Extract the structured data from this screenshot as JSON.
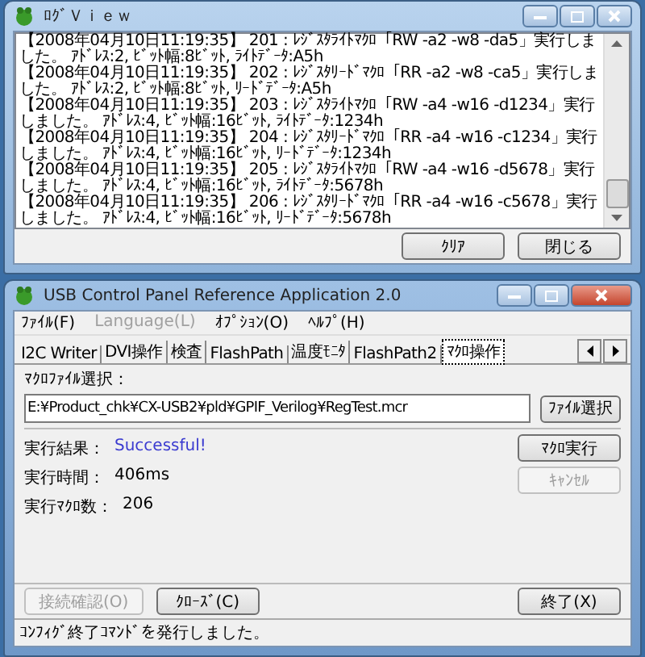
{
  "log_window": {
    "title": "ﾛｸﾞＶｉｅｗ",
    "lines": [
      "【2008年04月10日11:19:35】 201 : ﾚｼﾞｽﾀﾗｲﾄﾏｸﾛ「RW -a2 -w8 -da5」実行しました。 ｱﾄﾞﾚｽ:2, ﾋﾞｯﾄ幅:8ﾋﾞｯﾄ, ﾗｲﾄﾃﾞｰﾀ:A5h",
      "【2008年04月10日11:19:35】 202 : ﾚｼﾞｽﾀﾘｰﾄﾞﾏｸﾛ「RR -a2 -w8 -ca5」実行しました。 ｱﾄﾞﾚｽ:2, ﾋﾞｯﾄ幅:8ﾋﾞｯﾄ, ﾘｰﾄﾞﾃﾞｰﾀ:A5h",
      "【2008年04月10日11:19:35】 203 : ﾚｼﾞｽﾀﾗｲﾄﾏｸﾛ「RW -a4 -w16 -d1234」実行しました。 ｱﾄﾞﾚｽ:4, ﾋﾞｯﾄ幅:16ﾋﾞｯﾄ, ﾗｲﾄﾃﾞｰﾀ:1234h",
      "【2008年04月10日11:19:35】 204 : ﾚｼﾞｽﾀﾘｰﾄﾞﾏｸﾛ「RR -a4 -w16 -c1234」実行しました。 ｱﾄﾞﾚｽ:4, ﾋﾞｯﾄ幅:16ﾋﾞｯﾄ, ﾘｰﾄﾞﾃﾞｰﾀ:1234h",
      "【2008年04月10日11:19:35】 205 : ﾚｼﾞｽﾀﾗｲﾄﾏｸﾛ「RW -a4 -w16 -d5678」実行しました。 ｱﾄﾞﾚｽ:4, ﾋﾞｯﾄ幅:16ﾋﾞｯﾄ, ﾗｲﾄﾃﾞｰﾀ:5678h",
      "【2008年04月10日11:19:35】 206 : ﾚｼﾞｽﾀﾘｰﾄﾞﾏｸﾛ「RR -a4 -w16 -c5678」実行しました。 ｱﾄﾞﾚｽ:4, ﾋﾞｯﾄ幅:16ﾋﾞｯﾄ, ﾘｰﾄﾞﾃﾞｰﾀ:5678h"
    ],
    "buttons": [
      {
        "label": "ｸﾘｱ"
      },
      {
        "label": "閉じる"
      }
    ]
  },
  "main_window": {
    "title": "USB Control Panel Reference Application 2.0",
    "menu": [
      {
        "label": "ﾌｧｲﾙ(F)",
        "disabled": false
      },
      {
        "label": "Language(L)",
        "disabled": true
      },
      {
        "label": "ｵﾌﾟｼｮﾝ(O)",
        "disabled": false
      },
      {
        "label": "ﾍﾙﾌﾟ(H)",
        "disabled": false
      }
    ],
    "tabs": [
      {
        "label": "I2C Writer",
        "selected": false
      },
      {
        "label": "DVI操作",
        "selected": false
      },
      {
        "label": "検査",
        "selected": false
      },
      {
        "label": "FlashPath",
        "selected": false
      },
      {
        "label": "温度ﾓﾆﾀ",
        "selected": false
      },
      {
        "label": "FlashPath2",
        "selected": false
      },
      {
        "label": "ﾏｸﾛ操作",
        "selected": true
      }
    ],
    "macro_file": {
      "label": "ﾏｸﾛﾌｧｲﾙ選択：",
      "value": "E:¥Product_chk¥CX-USB2¥pld¥GPIF_Verilog¥RegTest.mcr",
      "button": "ﾌｧｲﾙ選択"
    },
    "results": [
      {
        "label": "実行結果：",
        "value": "Successful!",
        "kind": "success"
      },
      {
        "label": "実行時間：",
        "value": "406ms",
        "kind": "plain"
      },
      {
        "label": "実行ﾏｸﾛ数：",
        "value": "206",
        "kind": "plain"
      }
    ],
    "side_buttons": [
      {
        "label": "ﾏｸﾛ実行",
        "disabled": false
      },
      {
        "label": "ｷｬﾝｾﾙ",
        "disabled": true
      }
    ],
    "bottom_buttons": [
      {
        "label": "接続確認(O)",
        "disabled": true
      },
      {
        "label": "ｸﾛｰｽﾞ(C)",
        "disabled": false
      },
      {
        "label": "終了(X)",
        "disabled": false
      }
    ],
    "status_bar": "ｺﾝﾌｨｸﾞ終了ｺﾏﾝﾄﾞを発行しました。"
  }
}
